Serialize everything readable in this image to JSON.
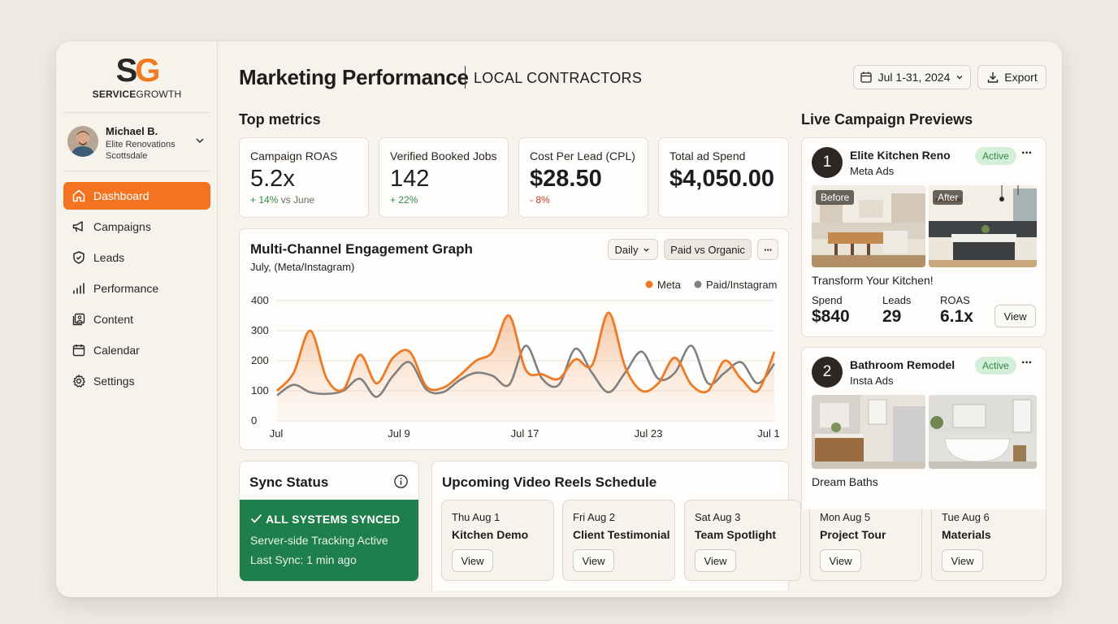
{
  "brand": {
    "mark_s": "S",
    "mark_g": "G",
    "name_bold": "SERVICE",
    "name_rest": "GROWTH"
  },
  "user": {
    "name": "Michael B.",
    "company": "Elite Renovations",
    "location": "Scottsdale"
  },
  "nav": [
    {
      "label": "Dashboard",
      "icon": "home-icon",
      "active": true
    },
    {
      "label": "Campaigns",
      "icon": "megaphone-icon"
    },
    {
      "label": "Leads",
      "icon": "shield-icon"
    },
    {
      "label": "Performance",
      "icon": "bars-icon"
    },
    {
      "label": "Content",
      "icon": "image-icon"
    },
    {
      "label": "Calendar",
      "icon": "calendar-icon"
    },
    {
      "label": "Settings",
      "icon": "gear-icon"
    }
  ],
  "header": {
    "title": "Marketing Performance",
    "subtitle": "LOCAL CONTRACTORS",
    "date_range": "Jul 1-31, 2024",
    "export_label": "Export"
  },
  "top_metrics": {
    "title": "Top metrics",
    "cards": [
      {
        "label": "Campaign ROAS",
        "value": "5.2x",
        "delta": "+ 14%",
        "delta_suffix": " vs June"
      },
      {
        "label": "Verified Booked Jobs",
        "value": "142",
        "delta": "+ 22%",
        "delta_suffix": ""
      },
      {
        "label": "Cost Per Lead (CPL)",
        "value": "$28.50",
        "delta": "- 8%",
        "delta_suffix": ""
      },
      {
        "label": "Total ad Spend",
        "value": "$4,050.00",
        "delta": "",
        "delta_suffix": ""
      }
    ]
  },
  "engagement": {
    "title": "Multi-Channel Engagement Graph",
    "subtitle": "July, (Meta/Instagram)",
    "granularity": "Daily",
    "compare": "Paid vs Organic",
    "more": "···"
  },
  "chart_data": {
    "type": "area",
    "x": [
      1,
      2,
      3,
      4,
      5,
      6,
      7,
      8,
      9,
      10,
      11,
      12,
      13,
      14,
      15,
      16,
      17,
      18,
      19,
      20,
      21,
      22,
      23,
      24,
      25,
      26,
      27,
      28,
      29,
      30,
      31
    ],
    "xticks": [
      "Jul",
      "Jul 9",
      "Jul 17",
      "Jul 23",
      "Jul 1"
    ],
    "ylim": [
      0,
      400
    ],
    "yticks": [
      "0",
      "100",
      "200",
      "300",
      "400"
    ],
    "series": [
      {
        "name": "Meta",
        "color": "#ee7a24",
        "values": [
          100,
          160,
          300,
          140,
          105,
          220,
          125,
          210,
          230,
          115,
          110,
          150,
          200,
          230,
          350,
          170,
          155,
          140,
          205,
          185,
          360,
          180,
          100,
          125,
          210,
          120,
          100,
          200,
          140,
          100,
          230
        ]
      },
      {
        "name": "Paid/Instagram",
        "color": "#808080",
        "values": [
          85,
          120,
          95,
          90,
          100,
          140,
          80,
          150,
          195,
          105,
          95,
          135,
          160,
          150,
          120,
          250,
          140,
          120,
          240,
          160,
          95,
          160,
          230,
          140,
          160,
          250,
          125,
          160,
          195,
          125,
          190
        ]
      }
    ]
  },
  "sync": {
    "title": "Sync Status",
    "status": "ALL SYSTEMS SYNCED",
    "line1": "Server-side Tracking Active",
    "line2": "Last Sync: 1 min ago"
  },
  "reels": {
    "title": "Upcoming Video Reels Schedule",
    "items": [
      {
        "date": "Thu Aug 1",
        "title": "Kitchen Demo",
        "action": "View"
      },
      {
        "date": "Fri Aug 2",
        "title": "Client Testimonial",
        "action": "View"
      },
      {
        "date": "Sat Aug 3",
        "title": "Team Spotlight",
        "action": "View"
      },
      {
        "date": "Mon Aug 5",
        "title": "Project Tour",
        "action": "View"
      },
      {
        "date": "Tue Aug 6",
        "title": "Materials",
        "action": "View"
      }
    ]
  },
  "previews": {
    "title": "Live Campaign Previews",
    "campaigns": [
      {
        "num": "1",
        "name": "Elite Kitchen Reno",
        "platform": "Meta Ads",
        "status": "Active",
        "before": "Before",
        "after": "After",
        "headline": "Transform Your Kitchen!",
        "spend_label": "Spend",
        "spend": "$840",
        "leads_label": "Leads",
        "leads": "29",
        "roas_label": "ROAS",
        "roas": "6.1x",
        "action": "View"
      },
      {
        "num": "2",
        "name": "Bathroom Remodel",
        "platform": "Insta Ads",
        "status": "Active",
        "headline": "Dream Baths"
      }
    ]
  }
}
